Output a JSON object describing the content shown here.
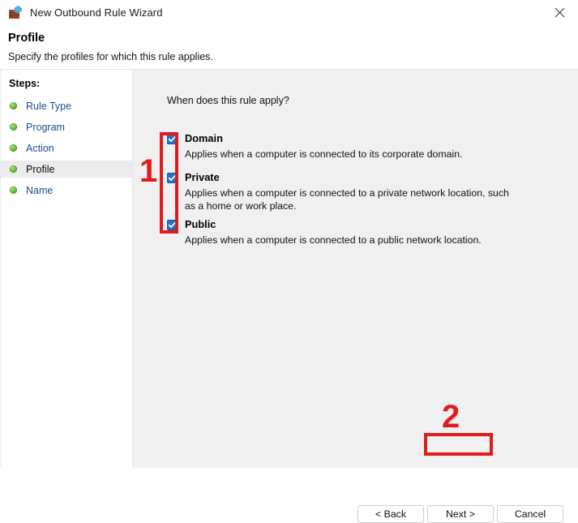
{
  "window": {
    "title": "New Outbound Rule Wizard",
    "icon": "firewall-brick-wall-globe-icon",
    "close_label": "✕"
  },
  "header": {
    "title": "Profile",
    "subtitle": "Specify the profiles for which this rule applies."
  },
  "sidebar": {
    "heading": "Steps:",
    "items": [
      {
        "label": "Rule Type",
        "current": false
      },
      {
        "label": "Program",
        "current": false
      },
      {
        "label": "Action",
        "current": false
      },
      {
        "label": "Profile",
        "current": true
      },
      {
        "label": "Name",
        "current": false
      }
    ]
  },
  "main": {
    "question": "When does this rule apply?",
    "options": [
      {
        "name": "Domain",
        "checked": true,
        "description": "Applies when a computer is connected to its corporate domain."
      },
      {
        "name": "Private",
        "checked": true,
        "description": "Applies when a computer is connected to a private network location, such as a home or work place."
      },
      {
        "name": "Public",
        "checked": true,
        "description": "Applies when a computer is connected to a public network location."
      }
    ]
  },
  "footer": {
    "back_label": "< Back",
    "next_label": "Next >",
    "cancel_label": "Cancel"
  },
  "annotations": [
    {
      "id": "1",
      "label": "1",
      "target": "profile-checkboxes"
    },
    {
      "id": "2",
      "label": "2",
      "target": "next-button"
    }
  ],
  "colors": {
    "accent_checkbox": "#1f73c4",
    "annotation_red": "#e01b1b",
    "link_blue": "#1a4f8a",
    "panel_gray": "#f0f0f0",
    "step_bullet_green": "#6fbf3c"
  }
}
